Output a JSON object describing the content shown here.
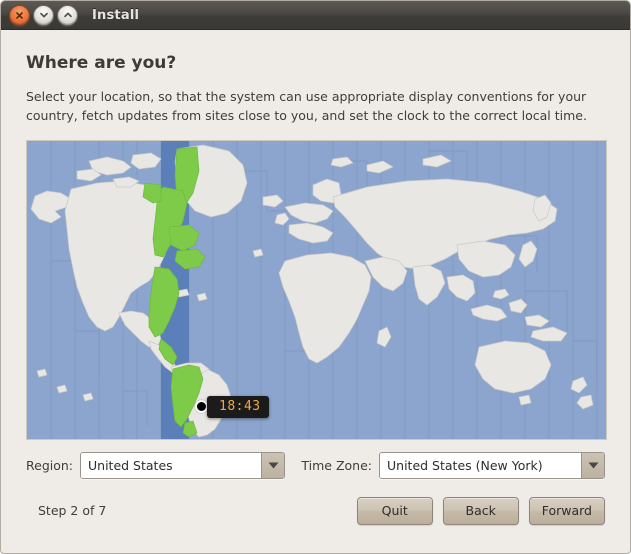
{
  "window": {
    "title": "Install",
    "controls": [
      {
        "name": "close",
        "icon": "close-icon"
      },
      {
        "name": "minimize",
        "icon": "chevron-down-icon"
      },
      {
        "name": "maximize",
        "icon": "chevron-up-icon"
      }
    ]
  },
  "page": {
    "title": "Where are you?",
    "description": "Select your location, so that the system can use appropriate display conventions for your country, fetch updates from sites close to you, and set the clock to the correct local time."
  },
  "map": {
    "tooltip_time": "18:43",
    "marker_icon": "location-dot-icon",
    "ocean_color": "#8ca5ce",
    "land_color": "#e8e7e4",
    "highlight_color": "#7ecb4a",
    "band_color": "#5b7fb8"
  },
  "selectors": {
    "region_label": "Region:",
    "region_value": "United States",
    "timezone_label": "Time Zone:",
    "timezone_value": "United States (New York)",
    "dropdown_icon": "chevron-down-icon"
  },
  "footer": {
    "step": "Step 2 of 7",
    "quit_label": "Quit",
    "back_label": "Back",
    "forward_label": "Forward"
  }
}
